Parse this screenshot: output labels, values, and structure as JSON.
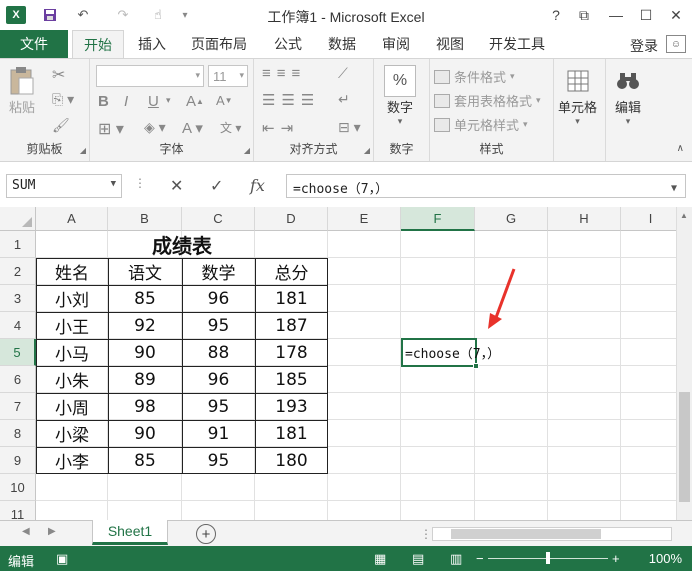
{
  "window": {
    "title": "工作簿1 - Microsoft Excel",
    "help": "?",
    "restore_icon": "⧉",
    "minimize": "—",
    "maximize": "☐",
    "close": "✕"
  },
  "quick_access": {
    "app_icon": "X",
    "save_icon": "💾",
    "undo_icon": "↶",
    "redo_icon": "↷",
    "touch_icon": "☝",
    "customize_icon": "▾"
  },
  "tabs": {
    "file": "文件",
    "items": [
      "开始",
      "插入",
      "页面布局",
      "公式",
      "数据",
      "审阅",
      "视图",
      "开发工具"
    ],
    "login": "登录"
  },
  "ribbon": {
    "clipboard": {
      "label": "剪贴板",
      "paste": "粘贴"
    },
    "font": {
      "label": "字体",
      "size": "11",
      "bold": "B",
      "italic": "I",
      "underline": "U"
    },
    "alignment": {
      "label": "对齐方式"
    },
    "number": {
      "label": "数字",
      "button": "数字",
      "icon": "%"
    },
    "styles": {
      "label": "样式",
      "conditional": "条件格式",
      "table": "套用表格格式",
      "cell": "单元格样式"
    },
    "cells": {
      "button": "单元格"
    },
    "editing": {
      "button": "编辑"
    }
  },
  "formula_bar": {
    "name_box": "SUM",
    "cancel": "✕",
    "enter": "✓",
    "fx": "fx",
    "content": "=choose（7，）"
  },
  "grid": {
    "columns": [
      "A",
      "B",
      "C",
      "D",
      "E",
      "F",
      "G",
      "H",
      "I"
    ],
    "rows": [
      "1",
      "2",
      "3",
      "4",
      "5",
      "6",
      "7",
      "8",
      "9",
      "10",
      "11"
    ],
    "selected_column": "F",
    "selected_row": "5",
    "table_title": "成绩表",
    "headers": [
      "姓名",
      "语文",
      "数学",
      "总分"
    ],
    "records": [
      [
        "小刘",
        "85",
        "96",
        "181"
      ],
      [
        "小王",
        "92",
        "95",
        "187"
      ],
      [
        "小马",
        "90",
        "88",
        "178"
      ],
      [
        "小朱",
        "89",
        "96",
        "185"
      ],
      [
        "小周",
        "98",
        "95",
        "193"
      ],
      [
        "小梁",
        "90",
        "91",
        "181"
      ],
      [
        "小李",
        "85",
        "95",
        "180"
      ]
    ],
    "active_cell_text": "=choose（7，）"
  },
  "sheets": {
    "active": "Sheet1",
    "add": "+"
  },
  "status": {
    "mode": "编辑",
    "zoom": "100%",
    "zoom_minus": "−",
    "zoom_plus": "+"
  },
  "colors": {
    "accent": "#217346",
    "arrow": "#e8322b"
  }
}
